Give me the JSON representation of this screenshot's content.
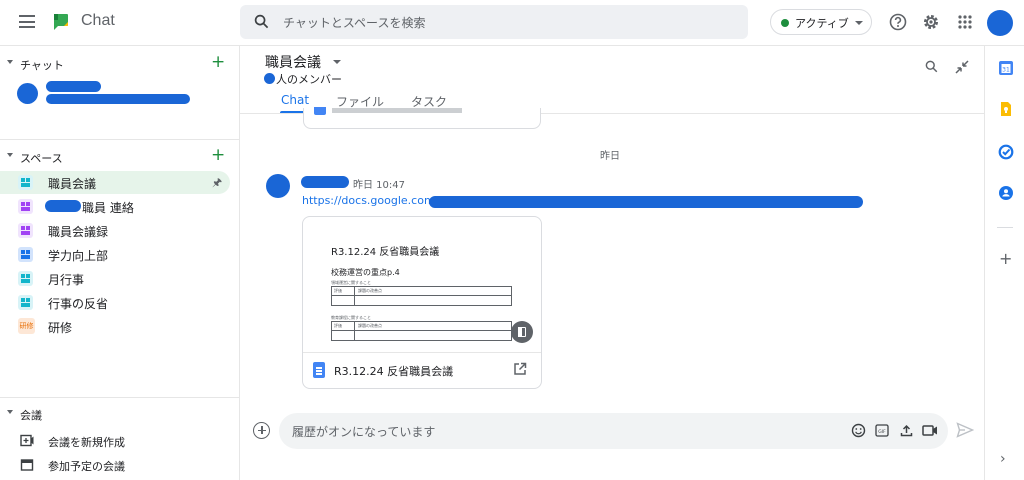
{
  "app": {
    "name": "Chat"
  },
  "search": {
    "placeholder": "チャットとスペースを検索"
  },
  "status": {
    "label": "アクティブ",
    "color": "#1e8e3e"
  },
  "sidebar": {
    "chat_header": "チャット",
    "spaces_header": "スペース",
    "spaces": [
      {
        "label": "職員会議",
        "color": "#12b5cb",
        "active": true
      },
      {
        "label": "職員 連絡",
        "color": "#a142f4"
      },
      {
        "label": "職員会議録",
        "color": "#a142f4"
      },
      {
        "label": "学力向上部",
        "color": "#1a73e8"
      },
      {
        "label": "月行事",
        "color": "#12b5cb"
      },
      {
        "label": "行事の反省",
        "color": "#12b5cb"
      },
      {
        "label": "研修",
        "icon_text": "研修"
      }
    ],
    "meetings_header": "会議",
    "meetings": [
      {
        "label": "会議を新規作成",
        "icon": "video-add-icon"
      },
      {
        "label": "参加予定の会議",
        "icon": "calendar-icon"
      }
    ]
  },
  "room": {
    "title": "職員会議",
    "members": "人のメンバー",
    "tabs": [
      "Chat",
      "ファイル",
      "タスク"
    ]
  },
  "messages": {
    "date_separator": "昨日",
    "time": "昨日 10:47",
    "link_prefix": "https://docs.google.com/"
  },
  "card": {
    "doc_title": "R3.12.24 反省職員会議",
    "doc_heading": "R3.12.24 反省職員会議",
    "doc_subheading": "校務運営の重点p.4",
    "doc_small_1": "領域運営に関すること",
    "doc_small_2": "教育課程に関すること",
    "table_col_1": "評価",
    "table_col_2": "課題の改善点"
  },
  "composer": {
    "placeholder": "履歴がオンになっています"
  },
  "colors": {
    "accent": "#1a73e8",
    "redaction": "#1a66d6"
  }
}
